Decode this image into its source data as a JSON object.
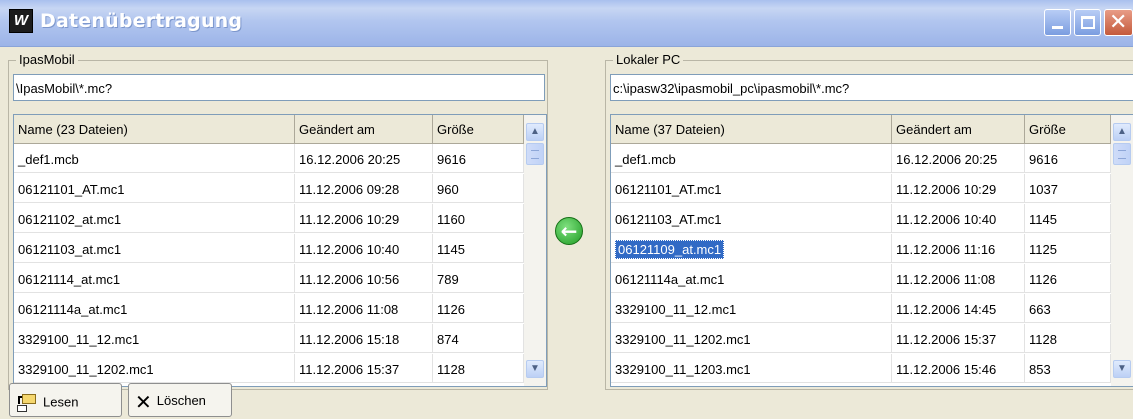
{
  "window": {
    "title": "Datenübertragung"
  },
  "left_panel": {
    "legend": "IpasMobil",
    "path": "\\IpasMobil\\*.mc?",
    "columns": [
      "Name   (23 Dateien)",
      "Geändert am",
      "Größe"
    ],
    "rows": [
      {
        "name": "_def1.mcb",
        "date": "16.12.2006 20:25",
        "size": "9616"
      },
      {
        "name": "06121101_AT.mc1",
        "date": "11.12.2006 09:28",
        "size": "960"
      },
      {
        "name": "06121102_at.mc1",
        "date": "11.12.2006 10:29",
        "size": "1160"
      },
      {
        "name": "06121103_at.mc1",
        "date": "11.12.2006 10:40",
        "size": "1145"
      },
      {
        "name": "06121114_at.mc1",
        "date": "11.12.2006 10:56",
        "size": "789"
      },
      {
        "name": "06121114a_at.mc1",
        "date": "11.12.2006 11:08",
        "size": "1126"
      },
      {
        "name": "3329100_11_12.mc1",
        "date": "11.12.2006 15:18",
        "size": "874"
      },
      {
        "name": "3329100_11_1202.mc1",
        "date": "11.12.2006 15:37",
        "size": "1128"
      }
    ]
  },
  "right_panel": {
    "legend": "Lokaler PC",
    "path": "c:\\ipasw32\\ipasmobil_pc\\ipasmobil\\*.mc?",
    "columns": [
      "Name   (37 Dateien)",
      "Geändert am",
      "Größe"
    ],
    "rows": [
      {
        "name": "_def1.mcb",
        "date": "16.12.2006 20:25",
        "size": "9616"
      },
      {
        "name": "06121101_AT.mc1",
        "date": "11.12.2006 10:29",
        "size": "1037"
      },
      {
        "name": "06121103_AT.mc1",
        "date": "11.12.2006 10:40",
        "size": "1145"
      },
      {
        "name": "06121109_at.mc1",
        "date": "11.12.2006 11:16",
        "size": "1125"
      },
      {
        "name": "06121114a_at.mc1",
        "date": "11.12.2006 11:08",
        "size": "1126"
      },
      {
        "name": "3329100_11_12.mc1",
        "date": "11.12.2006 14:45",
        "size": "663"
      },
      {
        "name": "3329100_11_1202.mc1",
        "date": "11.12.2006 15:37",
        "size": "1128"
      },
      {
        "name": "3329100_11_1203.mc1",
        "date": "11.12.2006 15:46",
        "size": "853"
      }
    ],
    "selected_row": "06121109_at.mc1"
  },
  "transfer": {
    "icon": "arrow-left-icon",
    "color": "#1f9c24"
  },
  "toolbar": {
    "read_label": "Lesen",
    "delete_label": "Löschen"
  },
  "colors": {
    "selection": "#316ac5",
    "titlebar": "#b2c6ef",
    "window_bg": "#ece9d8"
  }
}
